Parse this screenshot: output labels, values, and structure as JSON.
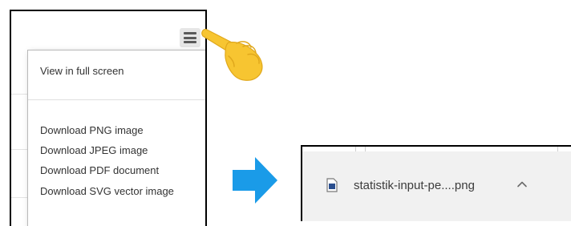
{
  "export_menu": {
    "items": [
      {
        "label": "View in full screen"
      },
      {
        "label": "Download PNG image"
      },
      {
        "label": "Download JPEG image"
      },
      {
        "label": "Download PDF document"
      },
      {
        "label": "Download SVG vector image"
      }
    ]
  },
  "icons": {
    "menu": "hamburger-menu-icon",
    "pointer": "pointing-hand-icon",
    "arrow": "right-arrow-icon",
    "file": "file-icon",
    "chevron": "chevron-up-icon"
  },
  "download_bar": {
    "file_name": "statistik-input-pe....png"
  },
  "colors": {
    "arrow": "#1a9be8",
    "hand": "#f7c531",
    "menu_button_bg": "#e6e6e6",
    "download_bar_bg": "#f1f1f1"
  }
}
